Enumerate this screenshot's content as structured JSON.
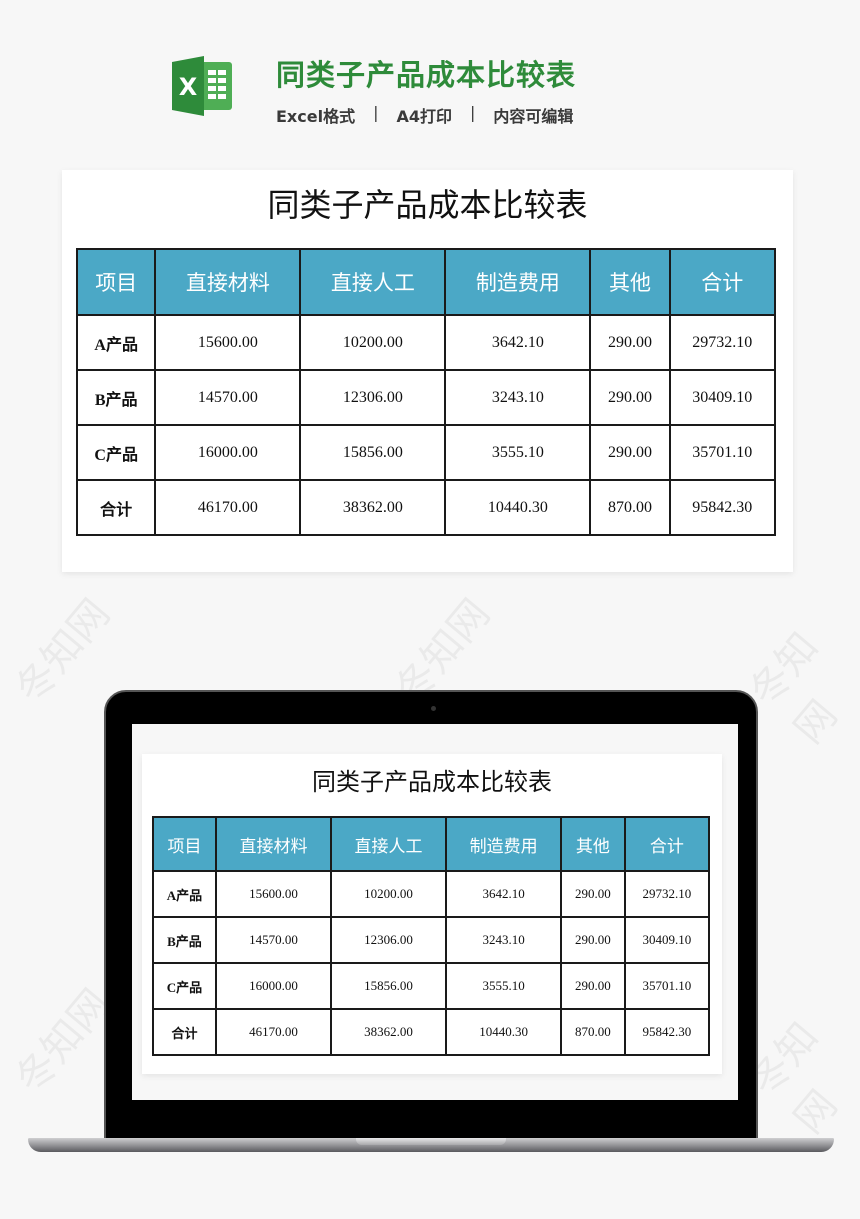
{
  "header": {
    "title": "同类子产品成本比较表",
    "subtitle_items": [
      "Excel格式",
      "A4打印",
      "内容可编辑"
    ],
    "separator": "|",
    "logo_icon": "excel-icon",
    "logo_letter": "X"
  },
  "sheet": {
    "title": "同类子产品成本比较表",
    "columns": [
      "项目",
      "直接材料",
      "直接人工",
      "制造费用",
      "其他",
      "合计"
    ],
    "rows": [
      {
        "label": "A产品",
        "values": [
          "15600.00",
          "10200.00",
          "3642.10",
          "290.00",
          "29732.10"
        ]
      },
      {
        "label": "B产品",
        "values": [
          "14570.00",
          "12306.00",
          "3243.10",
          "290.00",
          "30409.10"
        ]
      },
      {
        "label": "C产品",
        "values": [
          "16000.00",
          "15856.00",
          "3555.10",
          "290.00",
          "35701.10"
        ]
      },
      {
        "label": "合计",
        "values": [
          "46170.00",
          "38362.00",
          "10440.30",
          "870.00",
          "95842.30"
        ]
      }
    ]
  },
  "watermark": "冬知网",
  "colors": {
    "brand_green": "#2e8b3a",
    "header_blue": "#4ba8c6"
  }
}
